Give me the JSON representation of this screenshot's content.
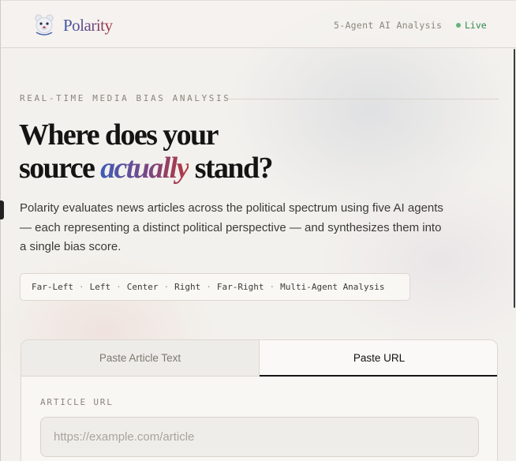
{
  "header": {
    "brand": "Polarity",
    "logo_icon": "bear-logo-icon",
    "agent_label": "5-Agent AI Analysis",
    "live_label": "Live",
    "live_color": "#64b37a"
  },
  "hero": {
    "eyebrow": "REAL-TIME MEDIA BIAS ANALYSIS",
    "headline_line1": "Where does your",
    "headline_pre": "source ",
    "headline_accent": "actually",
    "headline_post": " stand?",
    "accent_gradient": [
      "#3d5cb8",
      "#7a4684",
      "#b43a3e"
    ],
    "description": "Polarity evaluates news articles across the political spectrum using five AI agents — each representing a distinct political perspective — and synthesizes them into a single bias score."
  },
  "tags": {
    "items": [
      "Far-Left",
      "Left",
      "Center",
      "Right",
      "Far-Right",
      "Multi-Agent Analysis"
    ],
    "separator": "·"
  },
  "input_card": {
    "tabs": [
      {
        "label": "Paste Article Text",
        "active": false
      },
      {
        "label": "Paste URL",
        "active": true
      }
    ],
    "field_label": "ARTICLE URL",
    "url_placeholder": "https://example.com/article",
    "url_value": ""
  }
}
